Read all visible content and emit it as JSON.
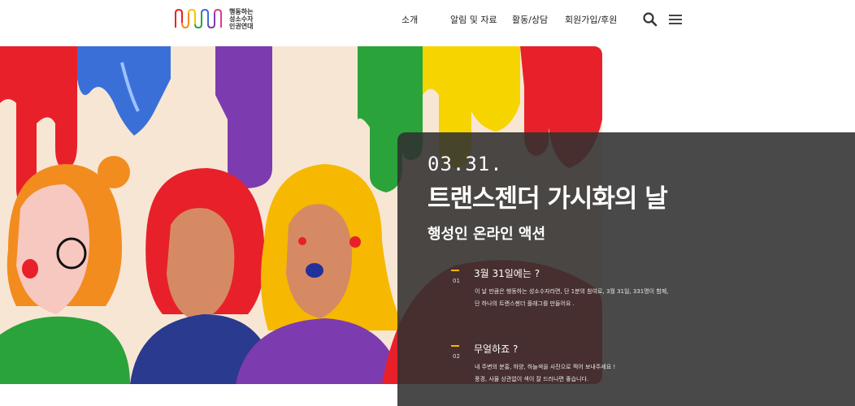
{
  "header": {
    "logo": {
      "line1": "행동하는",
      "line2": "성소수자",
      "line3": "인권연대"
    },
    "nav": [
      {
        "label": "소개"
      },
      {
        "label": "알림 및 자료"
      },
      {
        "label": "활동/상담"
      },
      {
        "label": "회원가입/후원"
      }
    ],
    "icons": {
      "search": "search-icon",
      "menu": "hamburger-menu-icon"
    }
  },
  "hero": {
    "date": "03.31.",
    "title": "트랜스젠더 가시화의 날",
    "subtitle": "행성인 온라인 액션",
    "items": [
      {
        "number": "01",
        "question": "3월 31일에는 ?",
        "line1": "이 날 만큼은 행동하는 성소수자라면, 단 1분의 참여로, 3월 31일, 331명이 함께,",
        "line2": "단 하나의 트랜스젠더 플래그를 만들어요 ."
      },
      {
        "number": "02",
        "question": "무얼하죠 ?",
        "line1": "내 주변의 분홍, 하양, 하늘색을 사진으로 찍어 보내주세요 !",
        "line2": "풍경, 사물 상관없이 색이 잘 드러나면 좋습니다."
      }
    ]
  },
  "colors": {
    "accent_bar": "#f2b600",
    "panel_bg": "#303030",
    "paint_red": "#e8202a",
    "paint_blue": "#3b6fd8",
    "paint_purple": "#7d3bb0",
    "paint_green": "#2aa33a",
    "paint_yellow": "#f6d400"
  }
}
